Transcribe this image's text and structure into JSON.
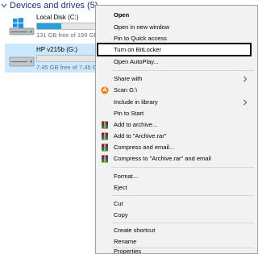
{
  "section": {
    "title": "Devices and drives (5)"
  },
  "drives": [
    {
      "name": "Local Disk (C:)",
      "free_text": "131 GB free of 199 GB",
      "used_fraction": 0.34,
      "selected": false
    },
    {
      "name": "HP v215b (G:)",
      "free_text": "7.45 GB free of 7.45 GB",
      "used_fraction": 0.0,
      "selected": true
    }
  ],
  "menu": {
    "items": {
      "open": "Open",
      "open_new_window": "Open in new window",
      "pin_quick_access": "Pin to Quick access",
      "turn_on_bitlocker": "Turn on BitLocker",
      "open_autoplay": "Open AutoPlay...",
      "share_with": "Share with",
      "scan": "Scan G:\\",
      "include_in_library": "Include in library",
      "pin_to_start": "Pin to Start",
      "add_to_archive": "Add to archive...",
      "add_to_archive_rar": "Add to \"Archive.rar\"",
      "compress_and_email": "Compress and email...",
      "compress_to_rar_email": "Compress to \"Archive.rar\" and email",
      "format": "Format...",
      "eject": "Eject",
      "cut": "Cut",
      "copy": "Copy",
      "create_shortcut": "Create shortcut",
      "rename": "Rename",
      "properties": "Properties"
    },
    "highlighted": "turn_on_bitlocker",
    "icons": {
      "scan": "avast-icon",
      "rar": "winrar-icon"
    }
  },
  "colors": {
    "section_title": "#1e3287",
    "selection": "#cce8ff",
    "usage_bar": "#26a0da",
    "menu_bg": "#f2f2f2",
    "avast_orange": "#f07800"
  }
}
